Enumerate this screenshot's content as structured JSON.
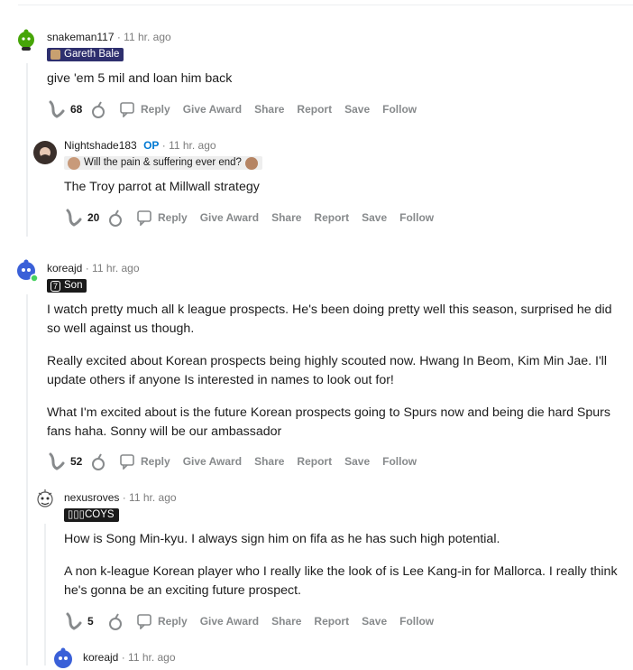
{
  "labels": {
    "reply": "Reply",
    "give_award": "Give Award",
    "share": "Share",
    "report": "Report",
    "save": "Save",
    "follow": "Follow"
  },
  "comments": [
    {
      "user": "snakeman117",
      "time": "11 hr. ago",
      "flair": "Gareth Bale",
      "body": [
        "give 'em 5 mil and loan him back"
      ],
      "score": "68"
    },
    {
      "user": "Nightshade183",
      "op": "OP",
      "time": "11 hr. ago",
      "flair": "Will the pain & suffering ever end?",
      "body": [
        "The Troy parrot at Millwall strategy"
      ],
      "score": "20"
    },
    {
      "user": "koreajd",
      "time": "11 hr. ago",
      "flair_badge": "7",
      "flair": "Son",
      "body": [
        "I watch pretty much all k league prospects. He's been doing pretty well this season, surprised he did",
        "so well against us though.",
        "Really excited about Korean prospects being highly scouted now. Hwang In Beom, Kim Min Jae. I'll",
        "update others if anyone Is interested in names to look out for!",
        "What I'm excited about is the future Korean prospects going to Spurs now and being die hard Spurs",
        "fans haha. Sonny will be our ambassador"
      ],
      "score": "52"
    },
    {
      "user": "nexusroves",
      "time": "11 hr. ago",
      "flair": "▯▯▯COYS",
      "body": [
        "How is Song Min-kyu. I always sign him on fifa as he has such high potential.",
        "A non k-league Korean player who I really like the look of is Lee Kang-in for Mallorca. I really think",
        "he's gonna be an exciting future prospect."
      ],
      "score": "5"
    },
    {
      "user": "koreajd",
      "time": "11 hr. ago"
    }
  ],
  "colors": {
    "accent": "#0079d3",
    "flair_dark": "#2e2f6e",
    "text_meta": "#7c7c7c",
    "action": "#878a8c"
  }
}
